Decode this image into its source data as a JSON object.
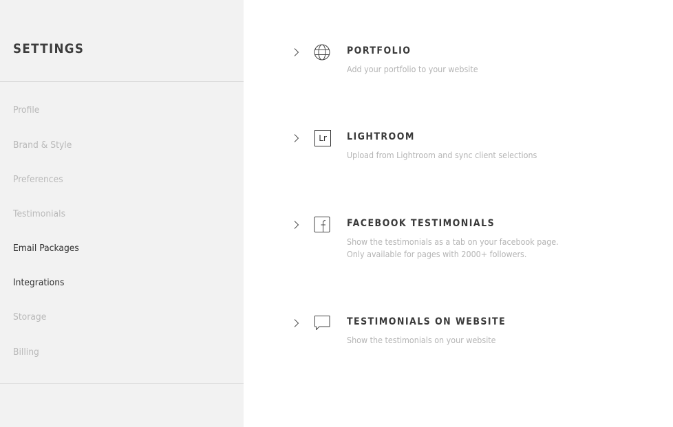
{
  "sidebar": {
    "title": "SETTINGS",
    "items": [
      {
        "label": "Profile",
        "state": "inactive"
      },
      {
        "label": "Brand & Style",
        "state": "inactive"
      },
      {
        "label": "Preferences",
        "state": "inactive"
      },
      {
        "label": "Testimonials",
        "state": "inactive"
      },
      {
        "label": "Email Packages",
        "state": "enabled"
      },
      {
        "label": "Integrations",
        "state": "selected"
      },
      {
        "label": "Storage",
        "state": "inactive"
      },
      {
        "label": "Billing",
        "state": "inactive"
      }
    ]
  },
  "integrations": [
    {
      "icon": "globe-icon",
      "title": "PORTFOLIO",
      "description": "Add your portfolio to your website"
    },
    {
      "icon": "lightroom-icon",
      "icon_text": "Lr",
      "title": "LIGHTROOM",
      "description": "Upload from Lightroom and sync client selections"
    },
    {
      "icon": "facebook-icon",
      "title": "FACEBOOK TESTIMONIALS",
      "description": "Show the testimonials as a tab on your facebook page.",
      "description_line2": "Only available for pages with 2000+ followers."
    },
    {
      "icon": "speech-bubble-icon",
      "title": "TESTIMONIALS ON WEBSITE",
      "description": "Show the testimonials on your website"
    }
  ],
  "colors": {
    "sidebar_bg": "#f2f2f2",
    "text_dark": "#3a3a3a",
    "text_muted": "#b4b4b4"
  }
}
